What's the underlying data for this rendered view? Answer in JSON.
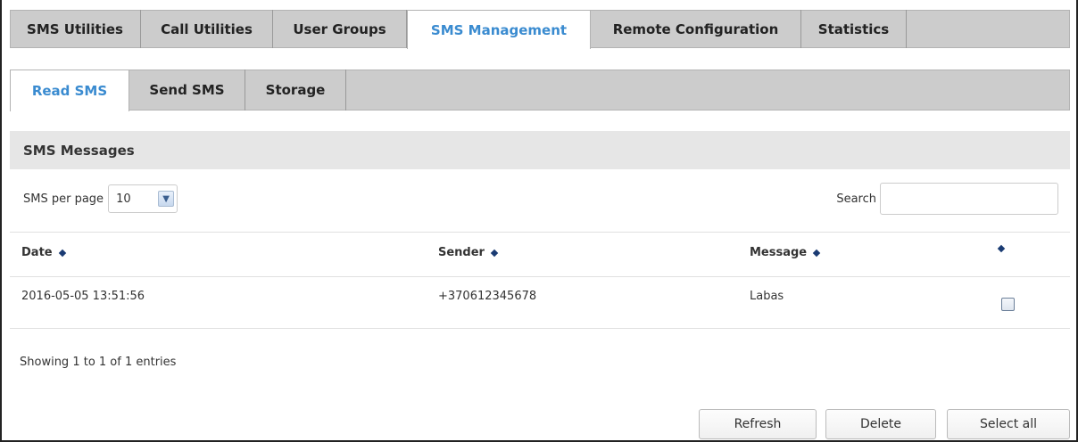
{
  "main_tabs": [
    {
      "label": "SMS Utilities"
    },
    {
      "label": "Call Utilities"
    },
    {
      "label": "User Groups"
    },
    {
      "label": "SMS Management"
    },
    {
      "label": "Remote Configuration"
    },
    {
      "label": "Statistics"
    }
  ],
  "sub_tabs": [
    {
      "label": "Read SMS"
    },
    {
      "label": "Send SMS"
    },
    {
      "label": "Storage"
    }
  ],
  "section": {
    "title": "SMS Messages"
  },
  "controls": {
    "per_page_label": "SMS per page",
    "per_page_value": "10",
    "search_label": "Search",
    "search_value": ""
  },
  "table": {
    "columns": [
      "Date",
      "Sender",
      "Message",
      ""
    ],
    "rows": [
      {
        "date": "2016-05-05 13:51:56",
        "sender": "+370612345678",
        "message": "Labas",
        "selected": false
      }
    ]
  },
  "info": "Showing 1 to 1 of 1 entries",
  "buttons": {
    "refresh": "Refresh",
    "delete": "Delete",
    "select_all": "Select all"
  },
  "colors": {
    "active_tab": "#3a8bd0",
    "sort_icon": "#1a3b73"
  }
}
